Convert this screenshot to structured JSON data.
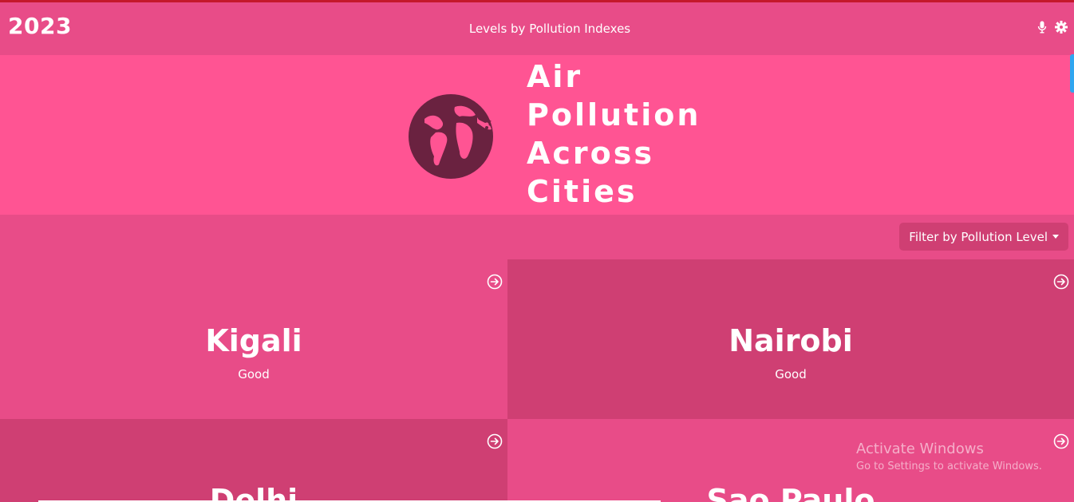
{
  "navbar": {
    "year": "2023",
    "title": "Levels by Pollution Indexes",
    "icons": [
      "microphone-icon",
      "gear-icon"
    ]
  },
  "hero": {
    "title_lines": [
      "Air",
      "Pollution",
      "Across",
      "Cities"
    ],
    "icon": "globe-icon"
  },
  "filter": {
    "label": "Filter by Pollution Level"
  },
  "cities": [
    {
      "name": "Kigali",
      "level": "Good"
    },
    {
      "name": "Nairobi",
      "level": "Good"
    },
    {
      "name": "Delhi",
      "level": ""
    },
    {
      "name": "Sao Paulo",
      "level": ""
    }
  ],
  "watermark": {
    "line1": "Activate Windows",
    "line2": "Go to Settings to activate Windows."
  },
  "colors": {
    "primary": "#e84c88",
    "hero": "#ff5493",
    "dark_card": "#cf3f73",
    "globe": "#6a2240"
  }
}
